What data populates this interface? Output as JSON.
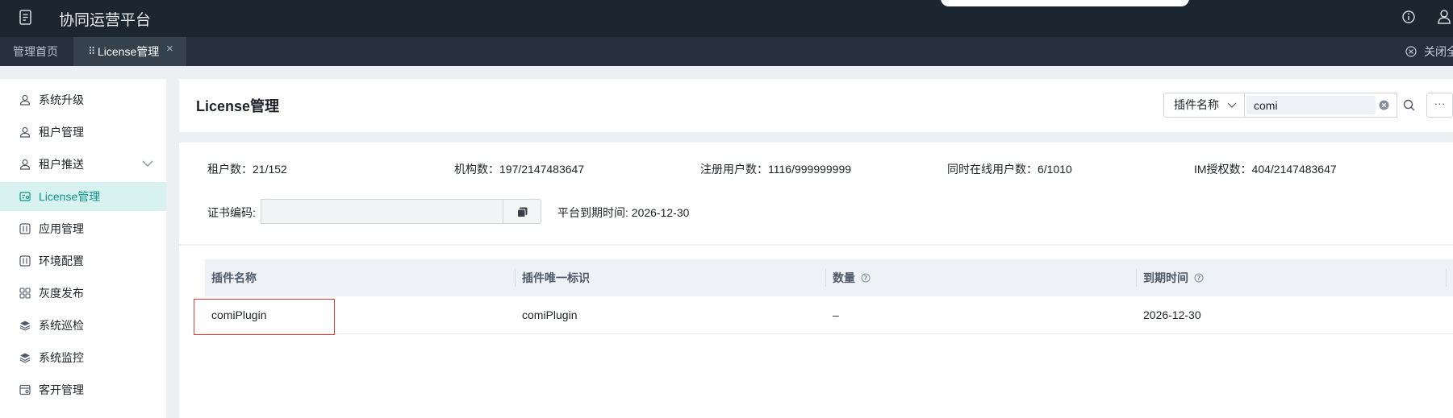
{
  "topbar": {
    "title": "协同运营平台"
  },
  "tabs": {
    "home_label": "管理首页",
    "active_label": "License管理",
    "close_all_label": "关闭全部"
  },
  "sidebar": {
    "items": [
      {
        "label": "系统升级"
      },
      {
        "label": "租户管理"
      },
      {
        "label": "租户推送"
      },
      {
        "label": "License管理"
      },
      {
        "label": "应用管理"
      },
      {
        "label": "环境配置"
      },
      {
        "label": "灰度发布"
      },
      {
        "label": "系统巡检"
      },
      {
        "label": "系统监控"
      },
      {
        "label": "客开管理"
      }
    ]
  },
  "header": {
    "title": "License管理",
    "filter_field": "插件名称",
    "search_value": "comi"
  },
  "stats": {
    "tenants": "租户数：21/152",
    "orgs": "机构数：197/2147483647",
    "registered_users": "注册用户数：1116/999999999",
    "concurrent_online": "同时在线用户数：6/1010",
    "im_licenses": "IM授权数：404/2147483647",
    "cert_label": "证书编码:",
    "platform_expiry": "平台到期时间: 2026-12-30"
  },
  "table": {
    "headers": [
      "插件名称",
      "插件唯一标识",
      "数量",
      "到期时间"
    ],
    "rows": [
      [
        "comiPlugin",
        "comiPlugin",
        "–",
        "2026-12-30"
      ]
    ]
  },
  "colors": {
    "accent": "#10958a",
    "highlight": "#e23a3a",
    "topbar": "#1c2630"
  }
}
